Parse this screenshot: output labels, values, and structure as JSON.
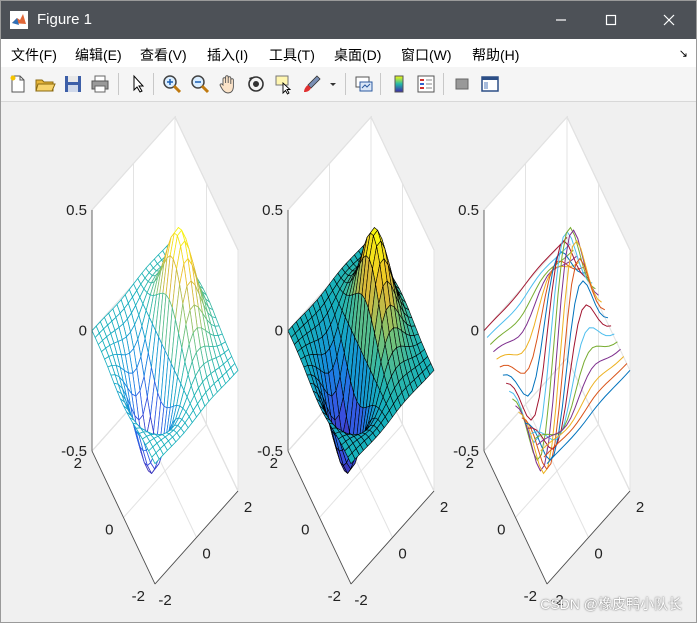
{
  "window": {
    "title": "Figure 1",
    "minimize_label": "—",
    "maximize_label": "☐",
    "close_label": "✕"
  },
  "menu": {
    "items": [
      "文件(F)",
      "编辑(E)",
      "查看(V)",
      "插入(I)",
      "工具(T)",
      "桌面(D)",
      "窗口(W)",
      "帮助(H)"
    ],
    "overflow_arrow": "↘"
  },
  "toolbar": {
    "icons": [
      "new-figure-icon",
      "open-file-icon",
      "save-icon",
      "print-icon",
      "select-arrow-icon",
      "zoom-in-icon",
      "zoom-out-icon",
      "pan-hand-icon",
      "rotate-3d-icon",
      "data-cursor-icon",
      "brush-icon",
      "link-plot-icon",
      "colorbar-icon",
      "legend-icon",
      "hide-plot-tools-icon",
      "show-plot-tools-icon"
    ]
  },
  "colors": {
    "titlebar": "#4d5157",
    "axes_edge": "#cfcfcf",
    "parula_low": "#3e26a8",
    "parula_mid": "#23b9aa",
    "parula_high": "#f9fb0e"
  },
  "watermark": "CSDN @橡皮鸭小队长",
  "chart_data": [
    {
      "type": "surface",
      "style": "mesh",
      "function": "x*exp(-x^2-y^2)",
      "x_range": [
        -2,
        2
      ],
      "y_range": [
        -2,
        2
      ],
      "zlim": [
        -0.5,
        0.5
      ],
      "z_ticks": [
        "0.5",
        "0",
        "-0.5"
      ],
      "x_ticks": [
        "-2",
        "0",
        "2"
      ],
      "y_ticks": [
        "-2",
        "0",
        "2"
      ],
      "grid_n": 21,
      "colormap": "parula"
    },
    {
      "type": "surface",
      "style": "surf",
      "function": "x*exp(-x^2-y^2)",
      "x_range": [
        -2,
        2
      ],
      "y_range": [
        -2,
        2
      ],
      "zlim": [
        -0.5,
        0.5
      ],
      "z_ticks": [
        "0.5",
        "0",
        "-0.5"
      ],
      "x_ticks": [
        "-2",
        "0",
        "2"
      ],
      "y_ticks": [
        "-2",
        "0",
        "2"
      ],
      "grid_n": 21,
      "colormap": "parula"
    },
    {
      "type": "line",
      "style": "plot3",
      "function": "x*exp(-x^2-y^2)",
      "x_range": [
        -2,
        2
      ],
      "y_range": [
        -2,
        2
      ],
      "zlim": [
        -0.5,
        0.5
      ],
      "z_ticks": [
        "0.5",
        "0",
        "-0.5"
      ],
      "x_ticks": [
        "-2",
        "0",
        "2"
      ],
      "y_ticks": [
        "-2",
        "0",
        "2"
      ],
      "grid_n": 21,
      "line_colors": [
        "#0072bd",
        "#d95319",
        "#edb120",
        "#7e2f8e",
        "#77ac30",
        "#4dbeee",
        "#a2142f"
      ]
    }
  ]
}
